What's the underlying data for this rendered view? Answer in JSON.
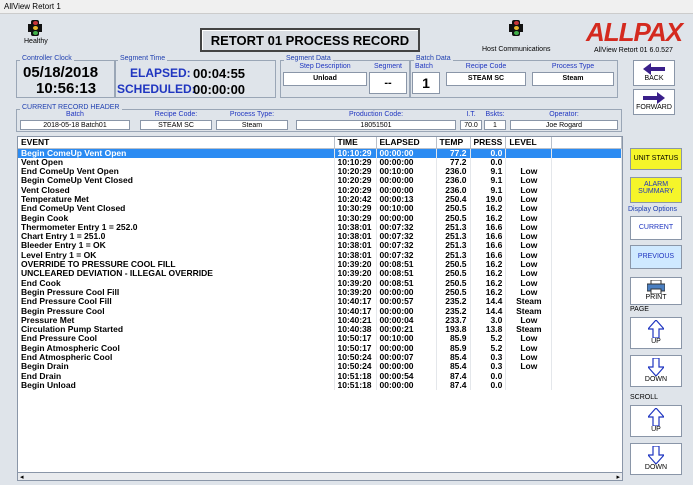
{
  "window": {
    "title": "AllView Retort 1"
  },
  "status_left": {
    "label": "Healthy"
  },
  "status_mid": {
    "label": "Host Communications"
  },
  "record_title": "RETORT 01 PROCESS RECORD",
  "logo": {
    "text": "ALLPAX",
    "version": "AllView Retort 01 6.0.527"
  },
  "controller_clock": {
    "legend": "Controller Clock",
    "date": "05/18/2018",
    "time": "10:56:13"
  },
  "segment_time": {
    "legend": "Segment Time",
    "elapsed_label": "ELAPSED:",
    "elapsed": "00:04:55",
    "scheduled_label": "SCHEDULED:",
    "scheduled": "00:00:00"
  },
  "segment_data": {
    "legend": "Segment Data",
    "step_label": "Step Description",
    "step": "Unload",
    "segment_label": "Segment",
    "segment": "--"
  },
  "batch_data": {
    "legend": "Batch Data",
    "batch_label": "Batch",
    "batch": "1",
    "recipe_label": "Recipe Code",
    "recipe": "STEAM SC",
    "process_label": "Process Type",
    "process": "Steam"
  },
  "current_record": {
    "legend": "CURRENT RECORD HEADER",
    "batch_label": "Batch",
    "batch": "2018-05-18 Batch01",
    "recipe_label": "Recipe Code:",
    "recipe": "STEAM SC",
    "process_label": "Process Type:",
    "process": "Steam",
    "production_label": "Production Code:",
    "production": "18051501",
    "it_label": "I.T.",
    "it": "70.0",
    "bskts_label": "Bskts:",
    "bskts": "1",
    "operator_label": "Operator:",
    "operator": "Joe Rogard"
  },
  "nav": {
    "back": "BACK",
    "forward": "FORWARD"
  },
  "side": {
    "unit_status": "UNIT STATUS",
    "alarm_summary_1": "ALARM",
    "alarm_summary_2": "SUMMARY",
    "display_options": "Display Options",
    "current": "CURRENT",
    "previous": "PREVIOUS",
    "print": "PRINT",
    "page": "PAGE",
    "up": "UP",
    "down": "DOWN",
    "scroll": "SCROLL",
    "scroll_up": "UP",
    "scroll_down": "DOWN"
  },
  "colors": {
    "accent_yellow": "#f5f52a",
    "selected_row": "#2b8bf2",
    "nav_arrow": "#3a1f8a",
    "logo_red": "#d42a1f"
  },
  "table": {
    "columns": [
      "EVENT",
      "TIME",
      "ELAPSED",
      "TEMP",
      "PRESS",
      "LEVEL"
    ],
    "rows": [
      [
        "Begin ComeUp Vent Open",
        "10:10:29",
        "00:00:00",
        "77.2",
        "0.0",
        ""
      ],
      [
        "Vent Open",
        "10:10:29",
        "00:00:00",
        "77.2",
        "0.0",
        ""
      ],
      [
        "End ComeUp Vent Open",
        "10:20:29",
        "00:10:00",
        "236.0",
        "9.1",
        "Low"
      ],
      [
        "Begin ComeUp Vent Closed",
        "10:20:29",
        "00:00:00",
        "236.0",
        "9.1",
        "Low"
      ],
      [
        "Vent Closed",
        "10:20:29",
        "00:00:00",
        "236.0",
        "9.1",
        "Low"
      ],
      [
        "Temperature Met",
        "10:20:42",
        "00:00:13",
        "250.4",
        "19.0",
        "Low"
      ],
      [
        "End ComeUp Vent Closed",
        "10:30:29",
        "00:10:00",
        "250.5",
        "16.2",
        "Low"
      ],
      [
        "Begin Cook",
        "10:30:29",
        "00:00:00",
        "250.5",
        "16.2",
        "Low"
      ],
      [
        "Thermometer Entry 1 = 252.0",
        "10:38:01",
        "00:07:32",
        "251.3",
        "16.6",
        "Low"
      ],
      [
        "Chart Entry 1 = 251.0",
        "10:38:01",
        "00:07:32",
        "251.3",
        "16.6",
        "Low"
      ],
      [
        "Bleeder Entry 1 = OK",
        "10:38:01",
        "00:07:32",
        "251.3",
        "16.6",
        "Low"
      ],
      [
        "Level Entry 1 = OK",
        "10:38:01",
        "00:07:32",
        "251.3",
        "16.6",
        "Low"
      ],
      [
        "OVERRIDE TO PRESSURE COOL FILL",
        "10:39:20",
        "00:08:51",
        "250.5",
        "16.2",
        "Low"
      ],
      [
        "UNCLEARED DEVIATION - ILLEGAL OVERRIDE",
        "10:39:20",
        "00:08:51",
        "250.5",
        "16.2",
        "Low"
      ],
      [
        "End Cook",
        "10:39:20",
        "00:08:51",
        "250.5",
        "16.2",
        "Low"
      ],
      [
        "Begin Pressure Cool Fill",
        "10:39:20",
        "00:00:00",
        "250.5",
        "16.2",
        "Low"
      ],
      [
        "End Pressure Cool Fill",
        "10:40:17",
        "00:00:57",
        "235.2",
        "14.4",
        "Steam"
      ],
      [
        "Begin Pressure Cool",
        "10:40:17",
        "00:00:00",
        "235.2",
        "14.4",
        "Steam"
      ],
      [
        "Pressure Met",
        "10:40:21",
        "00:00:04",
        "233.7",
        "3.0",
        "Low"
      ],
      [
        "Circulation Pump Started",
        "10:40:38",
        "00:00:21",
        "193.8",
        "13.8",
        "Steam"
      ],
      [
        "End Pressure Cool",
        "10:50:17",
        "00:10:00",
        "85.9",
        "5.2",
        "Low"
      ],
      [
        "Begin Atmospheric Cool",
        "10:50:17",
        "00:00:00",
        "85.9",
        "5.2",
        "Low"
      ],
      [
        "End Atmospheric Cool",
        "10:50:24",
        "00:00:07",
        "85.4",
        "0.3",
        "Low"
      ],
      [
        "Begin Drain",
        "10:50:24",
        "00:00:00",
        "85.4",
        "0.3",
        "Low"
      ],
      [
        "End Drain",
        "10:51:18",
        "00:00:54",
        "87.4",
        "0.0",
        ""
      ],
      [
        "Begin Unload",
        "10:51:18",
        "00:00:00",
        "87.4",
        "0.0",
        ""
      ]
    ]
  }
}
